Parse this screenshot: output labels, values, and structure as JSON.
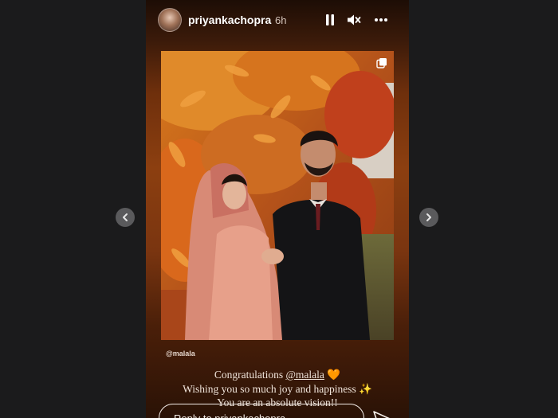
{
  "story": {
    "username": "priyankachopra",
    "time": "6h",
    "photo_tag": "@malala",
    "caption_lines": [
      {
        "prefix": "Congratulations ",
        "mention": "@malala",
        "suffix": " 🧡"
      },
      {
        "text": "Wishing you so much joy and happiness ✨"
      },
      {
        "text": "You are an absolute vision!!"
      }
    ],
    "reply_placeholder": "Reply to priyankachopra..."
  },
  "icons": {
    "prev": "chevron-left-icon",
    "next": "chevron-right-icon",
    "pause": "pause-icon",
    "mute": "speaker-muted-icon",
    "more": "more-options-icon",
    "copy": "multiple-photos-icon",
    "send": "paper-plane-icon"
  },
  "colors": {
    "page_background": "#1b1b1c",
    "story_background_top": "#1d0d05",
    "story_background_mid": "#8c3f10",
    "text_light": "#eee2d8"
  }
}
